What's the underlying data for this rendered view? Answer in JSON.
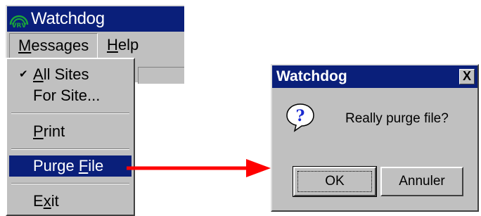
{
  "main_window": {
    "title": "Watchdog",
    "logo_text": "VRV"
  },
  "menubar": {
    "messages": {
      "accel": "M",
      "rest": "essages"
    },
    "help": {
      "accel": "H",
      "rest": "elp"
    }
  },
  "dropdown": {
    "all_sites": {
      "accel": "A",
      "rest": "ll Sites",
      "checked": true
    },
    "for_site": {
      "label": "For Site..."
    },
    "print": {
      "accel": "P",
      "rest": "rint"
    },
    "purge": {
      "pre": "Purge ",
      "accel": "F",
      "rest": "ile"
    },
    "exit": {
      "pre": "E",
      "accel": "x",
      "rest": "it"
    }
  },
  "dialog": {
    "title": "Watchdog",
    "close_glyph": "X",
    "message": "Really purge file?",
    "icon_glyph": "?",
    "ok_label": "OK",
    "cancel_label": "Annuler"
  },
  "colors": {
    "titlebar": "#0a1f7a",
    "selection": "#0a1f7a",
    "face": "#c0c0c0",
    "arrow": "#ff0000",
    "logo": "#1aa53a"
  }
}
